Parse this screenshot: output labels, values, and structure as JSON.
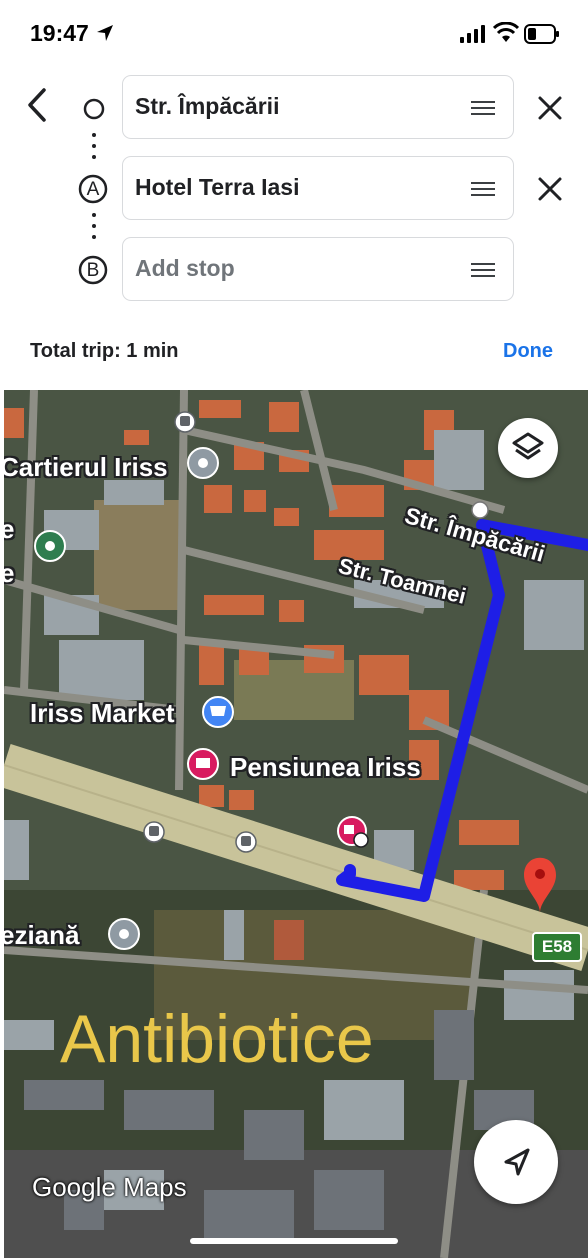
{
  "status_bar": {
    "time": "19:47"
  },
  "directions": {
    "origin": "Str. Împăcării",
    "destination_a": "Hotel Terra Iasi",
    "stop_b_placeholder": "Add stop",
    "marker_a": "A",
    "marker_b": "B"
  },
  "trip": {
    "total": "Total trip: 1 min",
    "done_label": "Done"
  },
  "map": {
    "labels": {
      "cartierul": "Cartierul Iriss",
      "impacarii": "Str. Împăcării",
      "toamnei": "Str. Toamnei",
      "market": "Iriss Market",
      "pensiunea": "Pensiunea Iriss",
      "veneziana": "eziană",
      "edge_e1": "e",
      "edge_e2": "e",
      "road_sign": "E58"
    },
    "watermark": "Antibiotice",
    "attribution": "Google Maps",
    "route_color": "#1e1ee6",
    "pin_color": "#ea4335"
  }
}
